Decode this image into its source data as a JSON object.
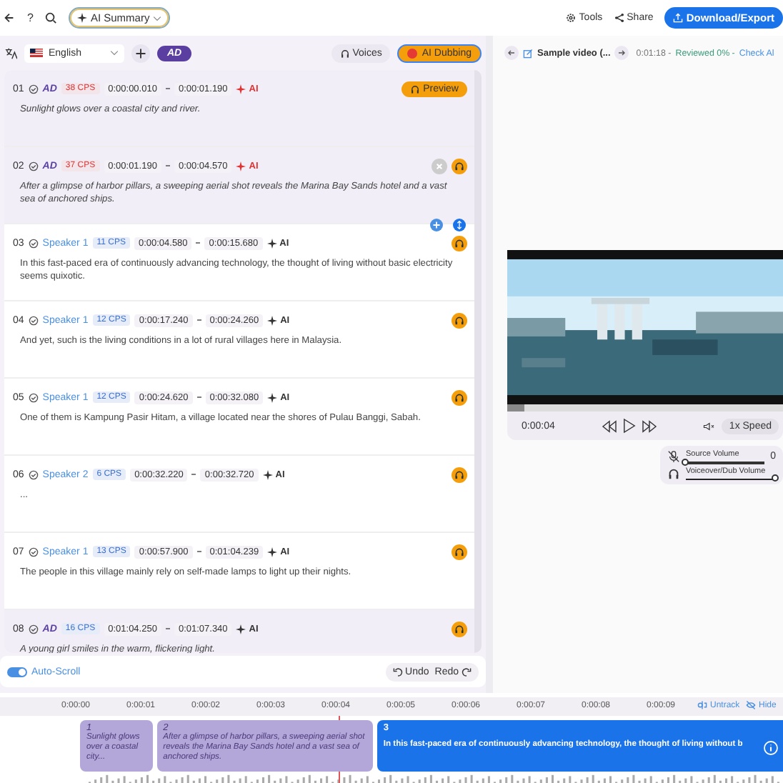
{
  "top_bar": {
    "help": "?",
    "ai_summary": "AI Summary",
    "tools": "Tools",
    "share": "Share",
    "download": "Download/Export"
  },
  "editor_toolbar": {
    "language": "English",
    "ad_label": "AD",
    "voices": "Voices",
    "ai_dubbing": "AI Dubbing"
  },
  "segments": [
    {
      "number": "01",
      "kind": "ad",
      "label": "AD",
      "cps": "38 CPS",
      "cps_warning": true,
      "start": "0:00:00.010",
      "end": "0:00:01.190",
      "ai": "AI",
      "text": "Sunlight glows over a coastal city and river.",
      "preview": "Preview"
    },
    {
      "number": "02",
      "kind": "ad",
      "label": "AD",
      "cps": "37 CPS",
      "cps_warning": true,
      "start": "0:00:01.190",
      "end": "0:00:04.570",
      "ai": "AI",
      "text": "After a glimpse of harbor pillars, a sweeping aerial shot reveals the Marina Bay Sands hotel and a vast sea of anchored ships.",
      "removable": true
    },
    {
      "number": "03",
      "kind": "speaker",
      "label": "Speaker 1",
      "cps": "11 CPS",
      "cps_warning": false,
      "start": "0:00:04.580",
      "end": "0:00:15.680",
      "ai": "AI",
      "text": "In this fast-paced era of continuously advancing technology, the thought of living without basic electricity seems quixotic.",
      "removable": false
    },
    {
      "number": "04",
      "kind": "speaker",
      "label": "Speaker 1",
      "cps": "12 CPS",
      "cps_warning": false,
      "start": "0:00:17.240",
      "end": "0:00:24.260",
      "ai": "AI",
      "text": "And yet, such is the living conditions in a lot of rural villages here in Malaysia.",
      "removable": false
    },
    {
      "number": "05",
      "kind": "speaker",
      "label": "Speaker 1",
      "cps": "12 CPS",
      "cps_warning": false,
      "start": "0:00:24.620",
      "end": "0:00:32.080",
      "ai": "AI",
      "text": "One of them is Kampung Pasir Hitam, a village located near the shores of Pulau Banggi, Sabah.",
      "removable": false
    },
    {
      "number": "06",
      "kind": "speaker",
      "label": "Speaker 2",
      "cps": "6 CPS",
      "cps_warning": false,
      "start": "0:00:32.220",
      "end": "0:00:32.720",
      "ai": "AI",
      "text": "...",
      "removable": false
    },
    {
      "number": "07",
      "kind": "speaker",
      "label": "Speaker 1",
      "cps": "13 CPS",
      "cps_warning": false,
      "start": "0:00:57.900",
      "end": "0:01:04.239",
      "ai": "AI",
      "text": "The people in this village mainly rely on self-made lamps to light up their nights.",
      "removable": false
    },
    {
      "number": "08",
      "kind": "ad",
      "label": "AD",
      "cps": "16 CPS",
      "cps_warning": false,
      "start": "0:01:04.250",
      "end": "0:01:07.340",
      "ai": "AI",
      "text": "A young girl smiles in the warm, flickering light.",
      "removable": false
    }
  ],
  "editor_footer": {
    "auto_scroll": {
      "label": "Auto-Scroll",
      "on": true
    },
    "undo": "Undo",
    "redo": "Redo"
  },
  "preview_header": {
    "title": "Sample video (...",
    "duration": "0:01:18 -",
    "reviewed": "Reviewed 0% -",
    "check": "Check Al"
  },
  "video": {
    "kind": "picture",
    "level": 0.06,
    "time": "0:00:04",
    "speed": "1x Speed"
  },
  "volume": [
    {
      "label": "Source Volume",
      "muted": true,
      "level": 0.0,
      "reading": "0"
    },
    {
      "label": "Voiceover/Dub Volume",
      "muted": false,
      "level": 1.0
    }
  ],
  "timeline": {
    "ticks": [
      "0:00:00",
      "0:00:01",
      "0:00:02",
      "0:00:03",
      "0:00:04",
      "0:00:05",
      "0:00:06",
      "0:00:07",
      "0:00:08",
      "0:00:09"
    ],
    "untrack": "Untrack",
    "hide": "Hide",
    "clips": [
      {
        "number": "1",
        "text": "Sunlight glows over a coastal city...",
        "selected": false
      },
      {
        "number": "2",
        "text": "After a glimpse of harbor pillars, a sweeping aerial shot reveals the Marina Bay Sands hotel and a vast sea of anchored ships.",
        "selected": false
      },
      {
        "number": "3",
        "text": "In this fast-paced era of continuously advancing technology, the thought of living without b",
        "selected": true
      }
    ]
  }
}
